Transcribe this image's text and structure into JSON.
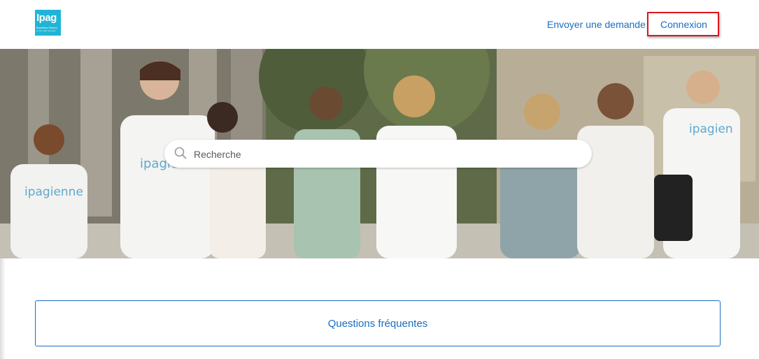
{
  "header": {
    "logo": {
      "word": "Ipag",
      "sub": "Business School",
      "tag": "on the right business"
    },
    "nav": {
      "submit_request": "Envoyer une demande",
      "sign_in": "Connexion"
    }
  },
  "hero": {
    "search": {
      "placeholder": "Recherche"
    },
    "shirt_texts": [
      "ipagienne",
      "ipagien",
      "ipagien"
    ]
  },
  "sections": {
    "faq_label": "Questions fréquentes"
  },
  "colors": {
    "link": "#1a6ec0",
    "brand": "#1fb5d6",
    "highlight": "#e0141c"
  }
}
